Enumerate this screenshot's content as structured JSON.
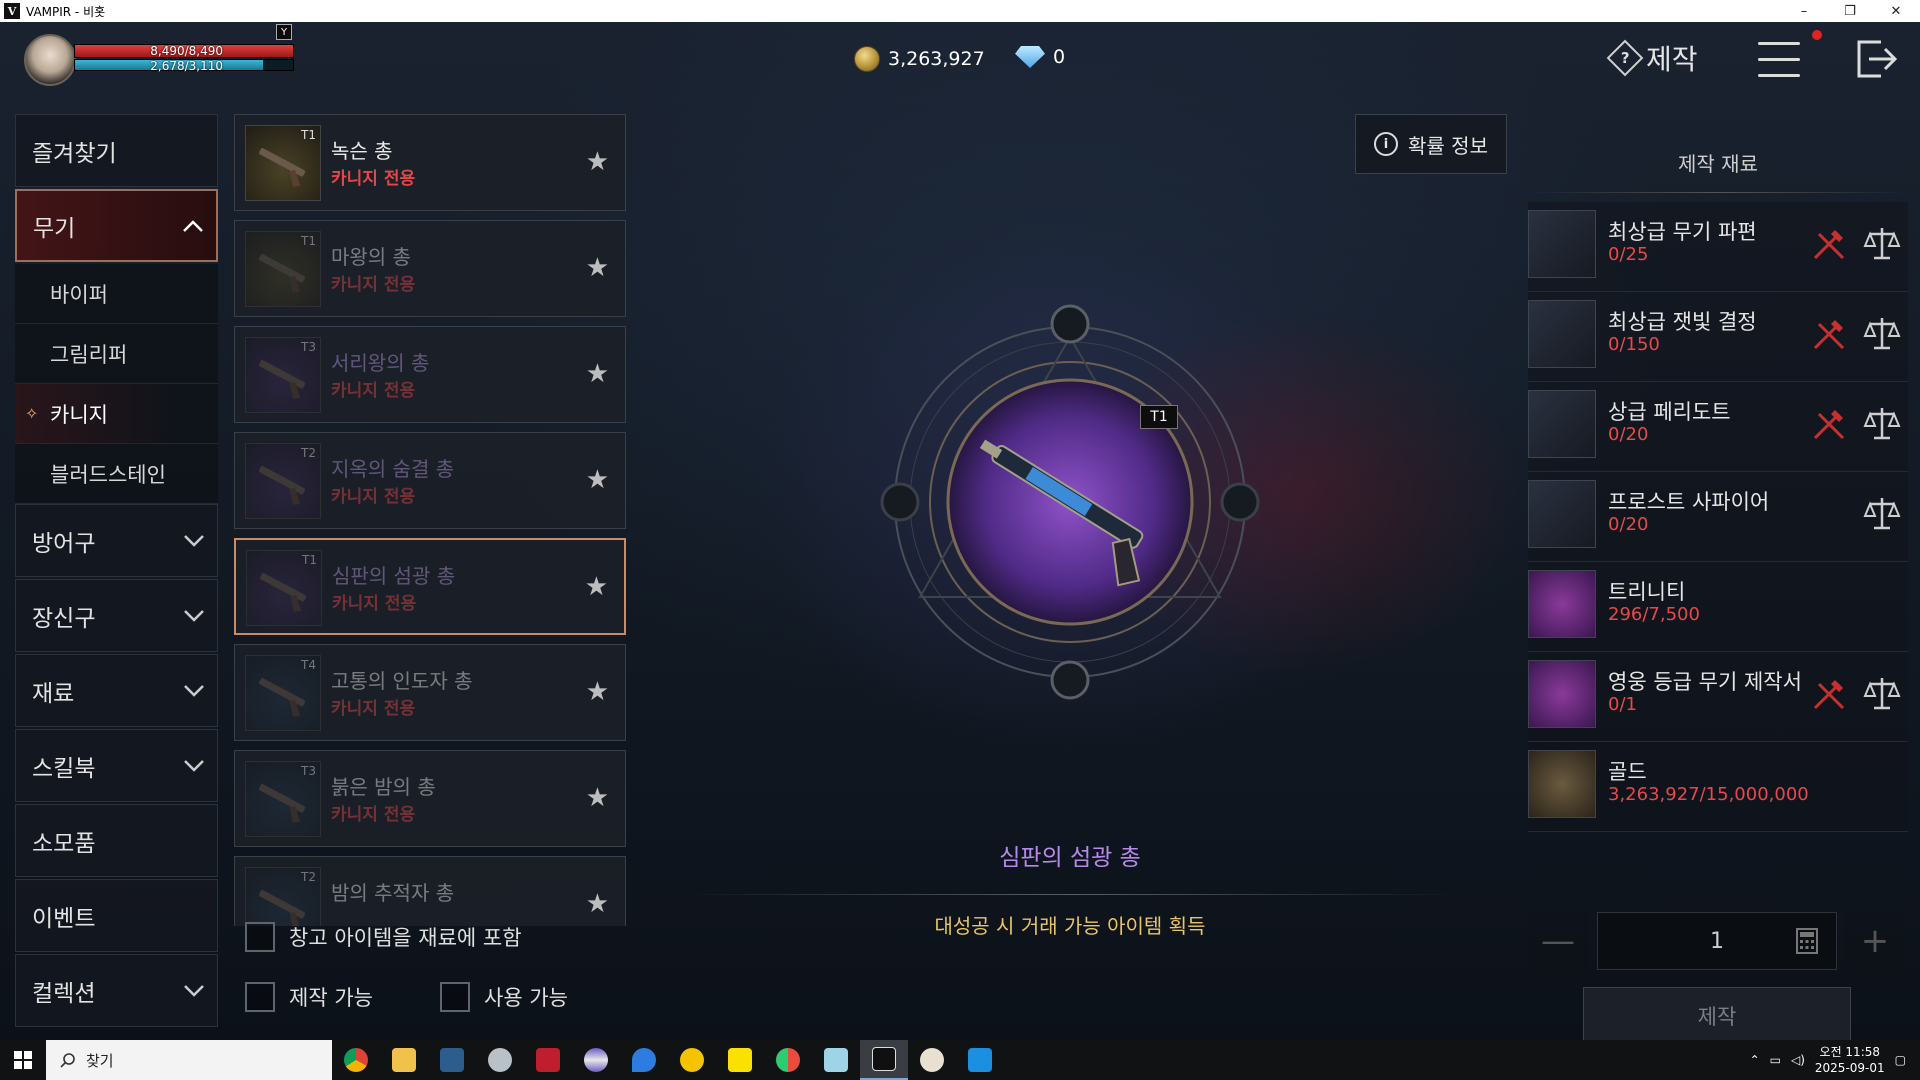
{
  "window": {
    "title": "VAMPIR - 비홋",
    "app_letter": "V",
    "controls": [
      "–",
      "❐",
      "✕"
    ]
  },
  "hud": {
    "hp_text": "8,490/8,490",
    "mp_text": "2,678/3,110",
    "hp_fraction": 1.0,
    "mp_fraction": 0.861,
    "y_key": "Y",
    "gold": "3,263,927",
    "gems": "0",
    "screen_title": "제작",
    "help_glyph": "?"
  },
  "categories": [
    {
      "label": "즐겨찾기",
      "expandable": false
    },
    {
      "label": "무기",
      "expandable": true,
      "expanded": true
    },
    {
      "label": "방어구",
      "expandable": true
    },
    {
      "label": "장신구",
      "expandable": true
    },
    {
      "label": "재료",
      "expandable": true
    },
    {
      "label": "스킬북",
      "expandable": true
    },
    {
      "label": "소모품",
      "expandable": false
    },
    {
      "label": "이벤트",
      "expandable": false
    },
    {
      "label": "컬렉션",
      "expandable": true
    }
  ],
  "weapon_subcategories": [
    {
      "label": "바이퍼"
    },
    {
      "label": "그림리퍼"
    },
    {
      "label": "카니지",
      "active": true,
      "mark": "✧"
    },
    {
      "label": "블러드스테인"
    }
  ],
  "items": [
    {
      "tier": "T1",
      "name": "녹슨 총",
      "sub": "카니지 전용",
      "faded": false,
      "purple": false,
      "thumb": "t-gold"
    },
    {
      "tier": "T1",
      "name": "마왕의 총",
      "sub": "카니지 전용",
      "faded": true,
      "purple": false,
      "thumb": "t-gold"
    },
    {
      "tier": "T3",
      "name": "서리왕의 총",
      "sub": "카니지 전용",
      "faded": true,
      "purple": true,
      "thumb": "t-purple"
    },
    {
      "tier": "T2",
      "name": "지옥의 숨결 총",
      "sub": "카니지 전용",
      "faded": true,
      "purple": true,
      "thumb": "t-purple"
    },
    {
      "tier": "T1",
      "name": "심판의 섬광 총",
      "sub": "카니지 전용",
      "faded": true,
      "purple": true,
      "thumb": "t-purple",
      "selected": true
    },
    {
      "tier": "T4",
      "name": "고통의 인도자 총",
      "sub": "카니지 전용",
      "faded": true,
      "purple": false,
      "thumb": "t-blue"
    },
    {
      "tier": "T3",
      "name": "붉은 밤의 총",
      "sub": "카니지 전용",
      "faded": true,
      "purple": false,
      "thumb": "t-blue"
    },
    {
      "tier": "T2",
      "name": "밤의 추적자 총",
      "sub": "",
      "faded": true,
      "purple": false,
      "thumb": "t-blue"
    }
  ],
  "star_glyph": "★",
  "filters": {
    "include_storage": "창고 아이템을 재료에 포함",
    "craftable": "제작 가능",
    "usable": "사용 가능"
  },
  "center": {
    "odds_button": "확률 정보",
    "info_glyph": "i",
    "tier_badge": "T1",
    "selected_name": "심판의 섬광 총",
    "great_success": "대성공 시 거래 가능 아이템 획득"
  },
  "materials": {
    "header": "제작 재료",
    "items": [
      {
        "name": "최상급 무기 파편",
        "qty": "0/25",
        "tool": true,
        "icon": "blade-shard-icon"
      },
      {
        "name": "최상급 잿빛 결정",
        "qty": "0/150",
        "tool": true,
        "icon": "ash-crystal-icon"
      },
      {
        "name": "상급 페리도트",
        "qty": "0/20",
        "tool": true,
        "icon": "peridot-icon"
      },
      {
        "name": "프로스트 사파이어",
        "qty": "0/20",
        "tool": false,
        "icon": "sapphire-icon"
      },
      {
        "name": "트리니티",
        "qty": "296/7,500",
        "tool": false,
        "scale": false,
        "icon": "trinity-icon"
      },
      {
        "name": "영웅 등급 무기 제작서",
        "qty": "0/1",
        "tool": true,
        "icon": "scroll-icon"
      },
      {
        "name": "골드",
        "qty": "3,263,927/15,000,000",
        "tool": false,
        "scale": false,
        "icon": "gold-coin-icon"
      }
    ]
  },
  "quantity": {
    "value": "1",
    "minus": "—",
    "plus": "+"
  },
  "craft_button": "제작",
  "taskbar": {
    "search_placeholder": "찾기",
    "clock_time": "오전 11:58",
    "clock_date": "2025-09-01"
  }
}
